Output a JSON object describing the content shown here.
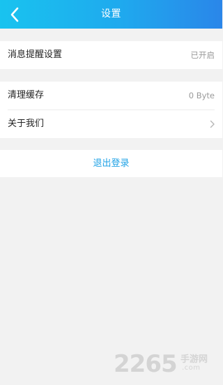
{
  "header": {
    "title": "设置",
    "back_icon": "chevron-left-icon",
    "gradient": [
      "#19c3ef",
      "#2a86e9"
    ]
  },
  "notification_group": {
    "items": [
      {
        "label": "消息提醒设置",
        "value": "已开启"
      }
    ]
  },
  "storage_group": {
    "items": [
      {
        "label": "清理缓存",
        "value": "0 Byte"
      },
      {
        "label": "关于我们",
        "icon": "chevron-right-icon"
      }
    ]
  },
  "logout": {
    "label": "退出登录",
    "color": "#1fa2e6"
  },
  "watermark": {
    "digits": "2265",
    "text": "手游网",
    "sub": ".com"
  }
}
